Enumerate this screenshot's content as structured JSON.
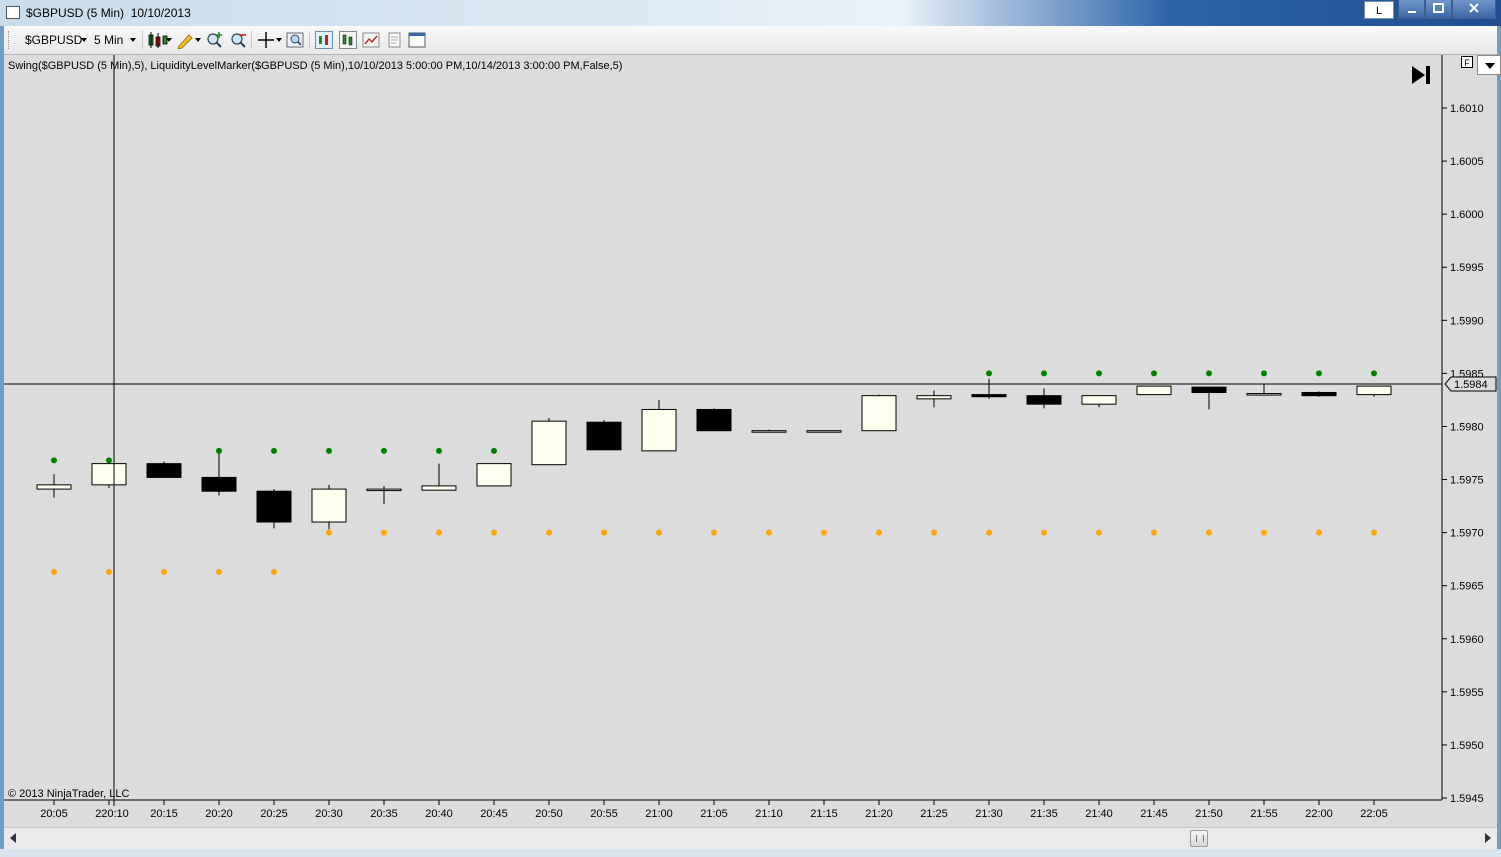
{
  "window": {
    "title": "$GBPUSD (5 Min)  10/10/2013",
    "layout_btn": "L",
    "minimize_icon": "minimize-icon",
    "maximize_icon": "maximize-icon",
    "close_icon": "close-icon"
  },
  "toolbar": {
    "instrument": "$GBPUSD",
    "interval": "5 Min",
    "icons": [
      "candlestick-chart-style-icon",
      "pencil-draw-icon",
      "zoom-in-icon",
      "zoom-out-icon",
      "crosshair-icon",
      "magnify-icon",
      "strategy-icon",
      "indicator-icon",
      "data-series-icon",
      "properties-icon",
      "window-layout-icon"
    ]
  },
  "chart": {
    "indicator_label": "Swing($GBPUSD (5 Min),5), LiquidityLevelMarker($GBPUSD (5 Min),10/10/2013 5:00:00 PM,10/14/2013 3:00:00 PM,False,5)",
    "copyright": "© 2013 NinjaTrader, LLC",
    "f_button": "F",
    "last_price_label": "1.5984",
    "skip_to_end_icon": "skip-to-end-icon",
    "colors": {
      "background": "#dcdcdc",
      "up_body": "#fffff0",
      "down_body": "#000000",
      "swing_high": "#008000",
      "swing_low": "#ffa500"
    }
  },
  "chart_data": {
    "type": "candlestick",
    "ylim": [
      1.5945,
      1.6013
    ],
    "yticks": [
      "1.6010",
      "1.6005",
      "1.6000",
      "1.5995",
      "1.5990",
      "1.5985",
      "1.5980",
      "1.5975",
      "1.5970",
      "1.5965",
      "1.5960",
      "1.5955",
      "1.5950",
      "1.5945"
    ],
    "x": [
      "20:05",
      "20:10",
      "20:15",
      "20:20",
      "20:25",
      "20:30",
      "20:35",
      "20:40",
      "20:45",
      "20:50",
      "20:55",
      "21:00",
      "21:05",
      "21:10",
      "21:15",
      "21:20",
      "21:25",
      "21:30",
      "21:35",
      "21:40",
      "21:45",
      "21:50",
      "21:55",
      "22:00",
      "22:05"
    ],
    "ohlc": [
      [
        1.59741,
        1.59755,
        1.59733,
        1.59745
      ],
      [
        1.59745,
        1.5977,
        1.59742,
        1.59765
      ],
      [
        1.59765,
        1.59767,
        1.59752,
        1.59752
      ],
      [
        1.59752,
        1.59775,
        1.59735,
        1.59739
      ],
      [
        1.59739,
        1.59741,
        1.59704,
        1.5971
      ],
      [
        1.5971,
        1.59745,
        1.59703,
        1.59741
      ],
      [
        1.59741,
        1.59744,
        1.59727,
        1.59741
      ],
      [
        1.5974,
        1.59765,
        1.5974,
        1.59744
      ],
      [
        1.59744,
        1.59765,
        1.59744,
        1.59765
      ],
      [
        1.59764,
        1.59808,
        1.59764,
        1.59805
      ],
      [
        1.59804,
        1.59806,
        1.59778,
        1.59778
      ],
      [
        1.59777,
        1.59825,
        1.59777,
        1.59816
      ],
      [
        1.59816,
        1.59817,
        1.59796,
        1.59796
      ],
      [
        1.59796,
        1.59797,
        1.59795,
        1.59796
      ],
      [
        1.59796,
        1.59796,
        1.59796,
        1.59796
      ],
      [
        1.59796,
        1.5983,
        1.59796,
        1.59829
      ],
      [
        1.59826,
        1.59834,
        1.59818,
        1.59829
      ],
      [
        1.5983,
        1.59845,
        1.59826,
        1.59828
      ],
      [
        1.59829,
        1.59836,
        1.59817,
        1.59821
      ],
      [
        1.59821,
        1.59829,
        1.59818,
        1.59829
      ],
      [
        1.5983,
        1.59838,
        1.5983,
        1.59838
      ],
      [
        1.59837,
        1.59837,
        1.59816,
        1.59832
      ],
      [
        1.5983,
        1.5984,
        1.5983,
        1.59831
      ],
      [
        1.59832,
        1.59833,
        1.59828,
        1.59829
      ],
      [
        1.5983,
        1.59838,
        1.59828,
        1.59838
      ]
    ],
    "swing_high": [
      1.59768,
      1.59768,
      null,
      1.59777,
      1.59777,
      1.59777,
      1.59777,
      1.59777,
      1.59777,
      null,
      null,
      null,
      null,
      null,
      null,
      null,
      null,
      1.5985,
      1.5985,
      1.5985,
      1.5985,
      1.5985,
      1.5985,
      1.5985,
      1.5985
    ],
    "swing_low": [
      1.59663,
      1.59663,
      1.59663,
      1.59663,
      1.59663,
      1.597,
      1.597,
      1.597,
      1.597,
      1.597,
      1.597,
      1.597,
      1.597,
      1.597,
      1.597,
      1.597,
      1.597,
      1.597,
      1.597,
      1.597,
      1.597,
      1.597,
      1.597,
      1.597,
      1.597
    ],
    "crosshair": {
      "time": "20:10",
      "price": 1.5984
    }
  }
}
